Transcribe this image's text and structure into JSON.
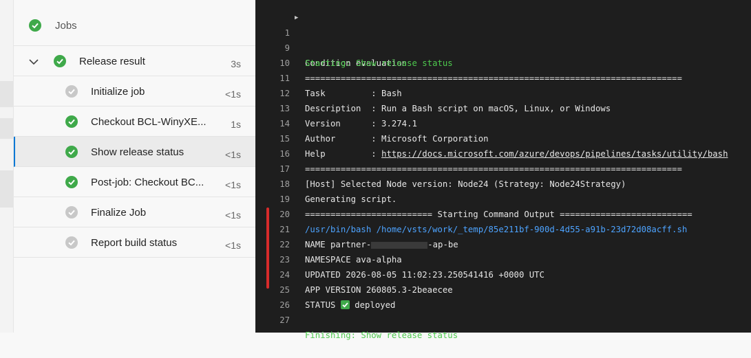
{
  "jobs_header": {
    "label": "Jobs"
  },
  "release": {
    "label": "Release result",
    "duration": "3s"
  },
  "steps": [
    {
      "label": "Initialize job",
      "duration": "<1s",
      "status": "skipped"
    },
    {
      "label": "Checkout BCL-WinyXE...",
      "duration": "1s",
      "status": "success"
    },
    {
      "label": "Show release status",
      "duration": "<1s",
      "status": "success"
    },
    {
      "label": "Post-job: Checkout BC...",
      "duration": "<1s",
      "status": "success"
    },
    {
      "label": "Finalize Job",
      "duration": "<1s",
      "status": "skipped"
    },
    {
      "label": "Report build status",
      "duration": "<1s",
      "status": "skipped"
    }
  ],
  "log_lines": [
    {
      "num": "1",
      "text": "Condition evaluation"
    },
    {
      "num": "9",
      "text": "Starting: Show release status"
    },
    {
      "num": "10",
      "text": "=========================================================================="
    },
    {
      "num": "11",
      "text": "Task         : Bash"
    },
    {
      "num": "12",
      "text": "Description  : Run a Bash script on macOS, Linux, or Windows"
    },
    {
      "num": "13",
      "text": "Version      : 3.274.1"
    },
    {
      "num": "14",
      "text": "Author       : Microsoft Corporation"
    },
    {
      "num": "15",
      "text_prefix": "Help         : ",
      "link": "https://docs.microsoft.com/azure/devops/pipelines/tasks/utility/bash"
    },
    {
      "num": "16",
      "text": "=========================================================================="
    },
    {
      "num": "17",
      "text": "[Host] Selected Node version: Node24 (Strategy: Node24Strategy)"
    },
    {
      "num": "18",
      "text": "Generating script."
    },
    {
      "num": "19",
      "text": "========================= Starting Command Output =========================="
    },
    {
      "num": "20",
      "text": "/usr/bin/bash /home/vsts/work/_temp/85e211bf-900d-4d55-a91b-23d72d08acff.sh"
    },
    {
      "num": "21",
      "text_prefix": "NAME partner-",
      "text_suffix": "-ap-be"
    },
    {
      "num": "22",
      "text": "NAMESPACE ava-alpha"
    },
    {
      "num": "23",
      "text": "UPDATED 2026-08-05 11:02:23.250541416 +0000 UTC"
    },
    {
      "num": "24",
      "text": "APP VERSION 260805.3-2beaecee"
    },
    {
      "num": "25",
      "text_prefix": "STATUS ",
      "text_suffix": " deployed"
    },
    {
      "num": "26",
      "text": ""
    },
    {
      "num": "27",
      "text": "Finishing: Show release status"
    }
  ],
  "colors": {
    "success": "#3fa94a",
    "skipped": "#c8c8c8",
    "accent": "#0078d4",
    "log_green": "#4ec94e",
    "link": "#4da3ff",
    "marker": "#d72b2b"
  }
}
